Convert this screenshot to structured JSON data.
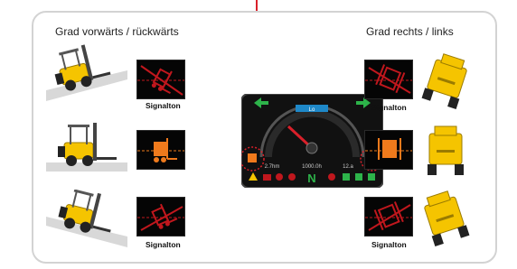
{
  "headings": {
    "left": "Grad vorwärts / rückwärts",
    "right": "Grad rechts / links"
  },
  "rows": {
    "left": [
      {
        "caption": "Signalton",
        "indicator_color": "#c0171d",
        "alert": true
      },
      {
        "caption": "",
        "indicator_color": "#f07a1c",
        "alert": false
      },
      {
        "caption": "Signalton",
        "indicator_color": "#c0171d",
        "alert": true
      }
    ],
    "right": [
      {
        "caption": "Signalton",
        "indicator_color": "#c0171d",
        "alert": true
      },
      {
        "caption": "",
        "indicator_color": "#f07a1c",
        "alert": false
      },
      {
        "caption": "Signalton",
        "indicator_color": "#c0171d",
        "alert": true
      }
    ]
  },
  "dashboard": {
    "hours_left": "2.7hm",
    "hours_mid": "1000.0h",
    "hours_right": "12.a",
    "gear": "N",
    "bar_label": "Lo"
  },
  "colors": {
    "accent": "#d9202a",
    "panel_border": "#d3d3d3",
    "forklift_yellow": "#f5c400",
    "dash_green": "#2db34a",
    "dash_blue": "#1e88c8"
  }
}
